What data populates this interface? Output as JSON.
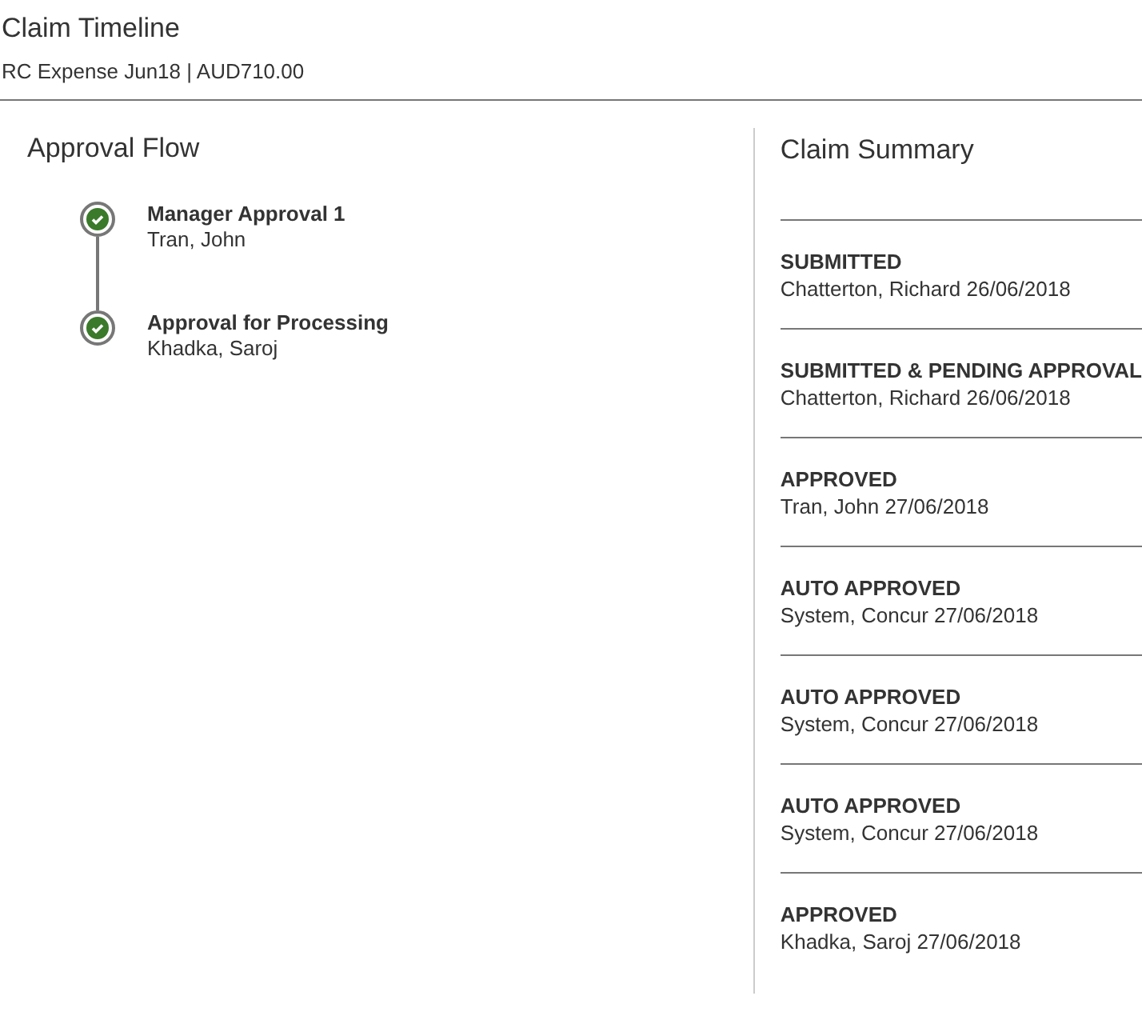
{
  "header": {
    "title": "Claim Timeline",
    "subtitle": "RC Expense Jun18 | AUD710.00"
  },
  "approval_flow": {
    "title": "Approval Flow",
    "steps": [
      {
        "title": "Manager Approval 1",
        "approver": "Tran, John",
        "done": true
      },
      {
        "title": "Approval for Processing",
        "approver": "Khadka, Saroj",
        "done": true
      }
    ]
  },
  "claim_summary": {
    "title": "Claim Summary",
    "entries": [
      {
        "status": "SUBMITTED",
        "detail": "Chatterton, Richard 26/06/2018"
      },
      {
        "status": "SUBMITTED & PENDING APPROVAL",
        "detail": "Chatterton, Richard 26/06/2018"
      },
      {
        "status": "APPROVED",
        "detail": "Tran, John 27/06/2018"
      },
      {
        "status": "AUTO APPROVED",
        "detail": "System, Concur 27/06/2018"
      },
      {
        "status": "AUTO APPROVED",
        "detail": "System, Concur 27/06/2018"
      },
      {
        "status": "AUTO APPROVED",
        "detail": "System, Concur 27/06/2018"
      },
      {
        "status": "APPROVED",
        "detail": "Khadka, Saroj 27/06/2018"
      }
    ]
  }
}
